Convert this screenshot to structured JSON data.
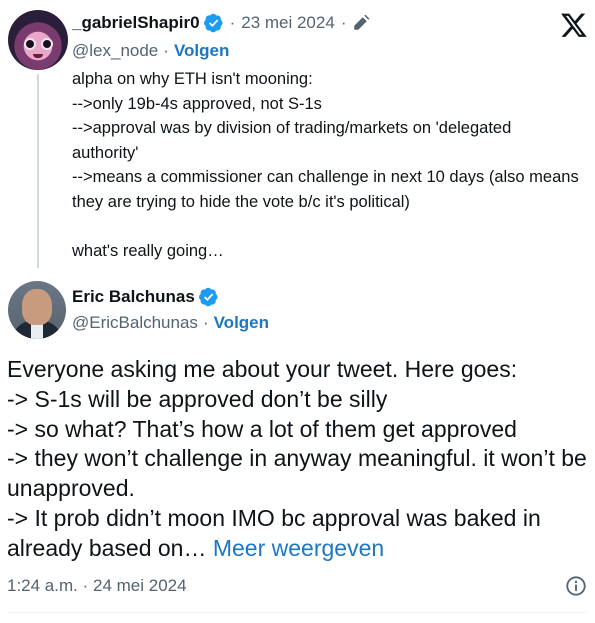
{
  "quoted_tweet": {
    "author_name": "_gabrielShapir0",
    "post_date": "23 mei 2024",
    "handle": "@lex_node",
    "follow_label": "Volgen",
    "body_lines": [
      "alpha on why ETH isn't mooning:",
      "-->only 19b-4s approved, not S-1s",
      "-->approval was by division of trading/markets on 'delegated authority'",
      "-->means a commissioner can challenge in next 10 days (also means they are trying to hide the vote b/c it's political)",
      "",
      "what's really going…"
    ]
  },
  "main_tweet": {
    "author_name": "Eric Balchunas",
    "handle": "@EricBalchunas",
    "follow_label": "Volgen",
    "body_lines": [
      "Everyone asking me about your tweet. Here goes:",
      "-> S-1s will be approved don’t be silly",
      "-> so what? That’s how a lot of them get approved",
      "-> they won’t challenge in anyway meaningful. it won’t be unapproved.",
      "-> It prob didn’t moon IMO bc approval was baked in already based on…"
    ],
    "show_more_label": "Meer weergeven",
    "timestamp": "1:24 a.m.",
    "date": "24 mei 2024"
  },
  "icons": {
    "verified": "verified-badge-icon",
    "edit": "pencil-icon",
    "platform": "x-logo-icon",
    "info": "info-icon"
  },
  "colors": {
    "link": "#1d77c2",
    "verified": "#1d9bf0",
    "secondary_text": "#536471",
    "text": "#0f1419"
  }
}
